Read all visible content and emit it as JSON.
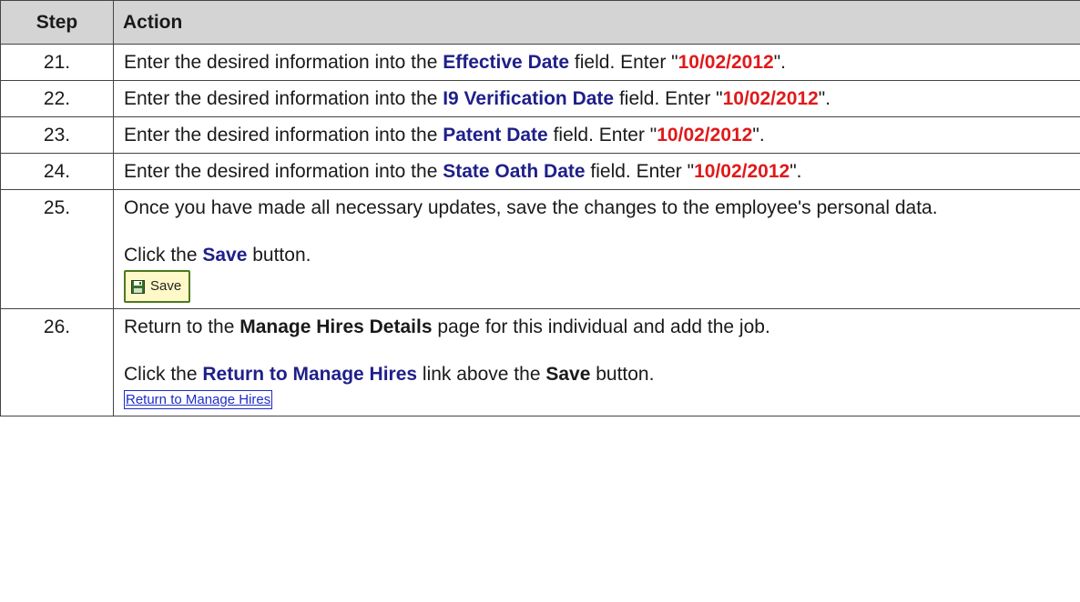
{
  "headers": {
    "step": "Step",
    "action": "Action"
  },
  "rows": [
    {
      "num": "21.",
      "pre": "Enter the desired information into the ",
      "field": "Effective Date",
      "mid": " field. Enter \"",
      "value": "10/02/2012",
      "post": "\"."
    },
    {
      "num": "22.",
      "pre": "Enter the desired information into the ",
      "field": "I9 Verification Date",
      "mid": " field. Enter \"",
      "value": "10/02/2012",
      "post": "\"."
    },
    {
      "num": "23.",
      "pre": "Enter the desired information into the ",
      "field": "Patent Date",
      "mid": " field. Enter \"",
      "value": "10/02/2012",
      "post": "\"."
    },
    {
      "num": "24.",
      "pre": "Enter the desired information into the ",
      "field": "State Oath Date",
      "mid": " field. Enter \"",
      "value": "10/02/2012",
      "post": "\"."
    }
  ],
  "row25": {
    "num": "25.",
    "text": "Once you have made all necessary updates, save the changes to the employee's personal data.",
    "click_pre": "Click the ",
    "click_field": "Save",
    "click_post": " button.",
    "button_label": "Save",
    "button_icon": "floppy-disk-icon"
  },
  "row26": {
    "num": "26.",
    "pre": "Return to the ",
    "page": "Manage Hires Details",
    "post": " page for this individual  and add the job.",
    "click_pre": "Click the ",
    "click_field": "Return to Manage Hires",
    "click_mid": " link above the ",
    "click_bold": "Save",
    "click_post": " button.",
    "link_label": "Return to Manage Hires"
  },
  "colors": {
    "field": "#1f1f8a",
    "value": "#e0191b",
    "header_bg": "#d4d4d4",
    "link": "#1d2cc9"
  }
}
